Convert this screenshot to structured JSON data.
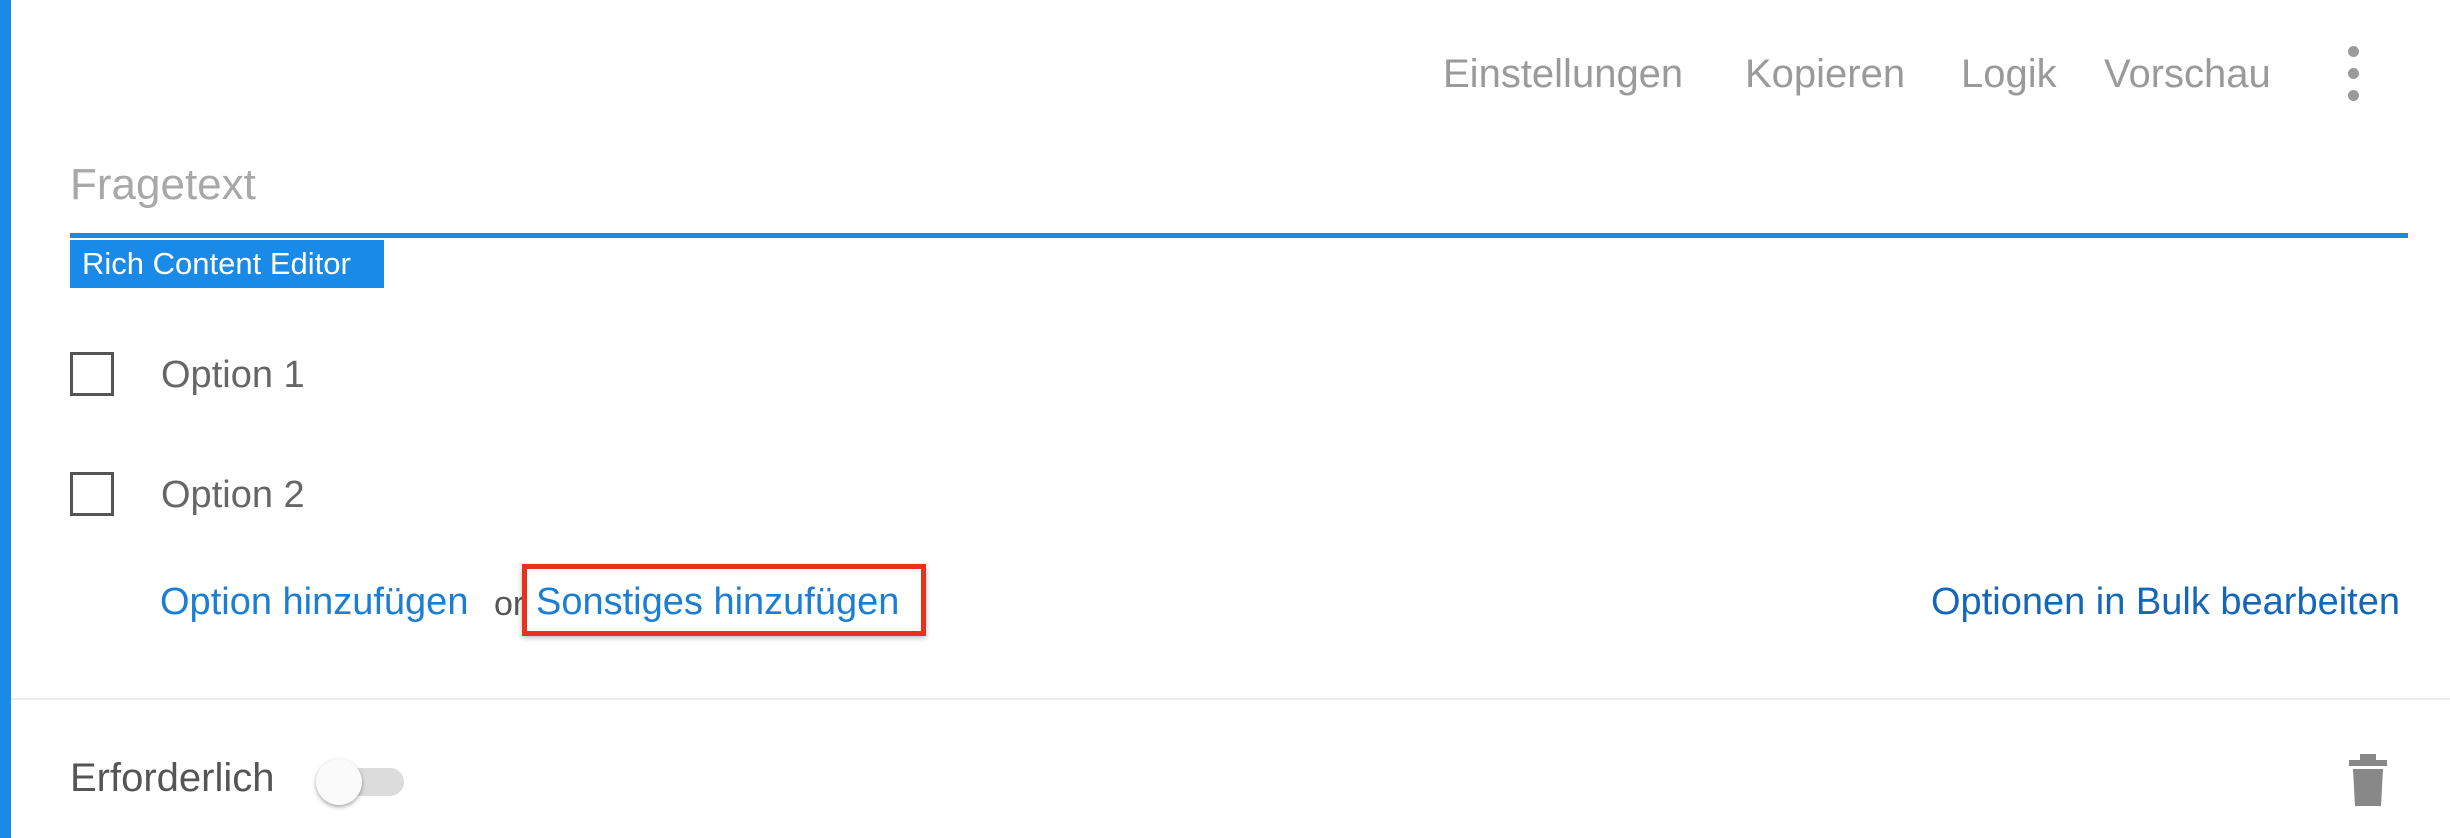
{
  "toolbar": {
    "settings": "Einstellungen",
    "copy": "Kopieren",
    "logic": "Logik",
    "preview": "Vorschau",
    "more_icon": "more-vert-icon"
  },
  "question": {
    "placeholder": "Fragetext",
    "value": "",
    "rich_editor_label": "Rich Content Editor"
  },
  "options": [
    {
      "label": "Option 1",
      "checked": false
    },
    {
      "label": "Option 2",
      "checked": false
    }
  ],
  "add": {
    "add_option": "Option hinzufügen",
    "or": "or",
    "add_other": "Sonstiges hinzufügen",
    "bulk_edit": "Optionen in Bulk bearbeiten"
  },
  "footer": {
    "required_label": "Erforderlich",
    "required_on": false,
    "delete_icon": "trash-icon"
  },
  "colors": {
    "accent": "#1a8ae8",
    "link": "#1a7fd4",
    "highlight": "#e8321f"
  }
}
